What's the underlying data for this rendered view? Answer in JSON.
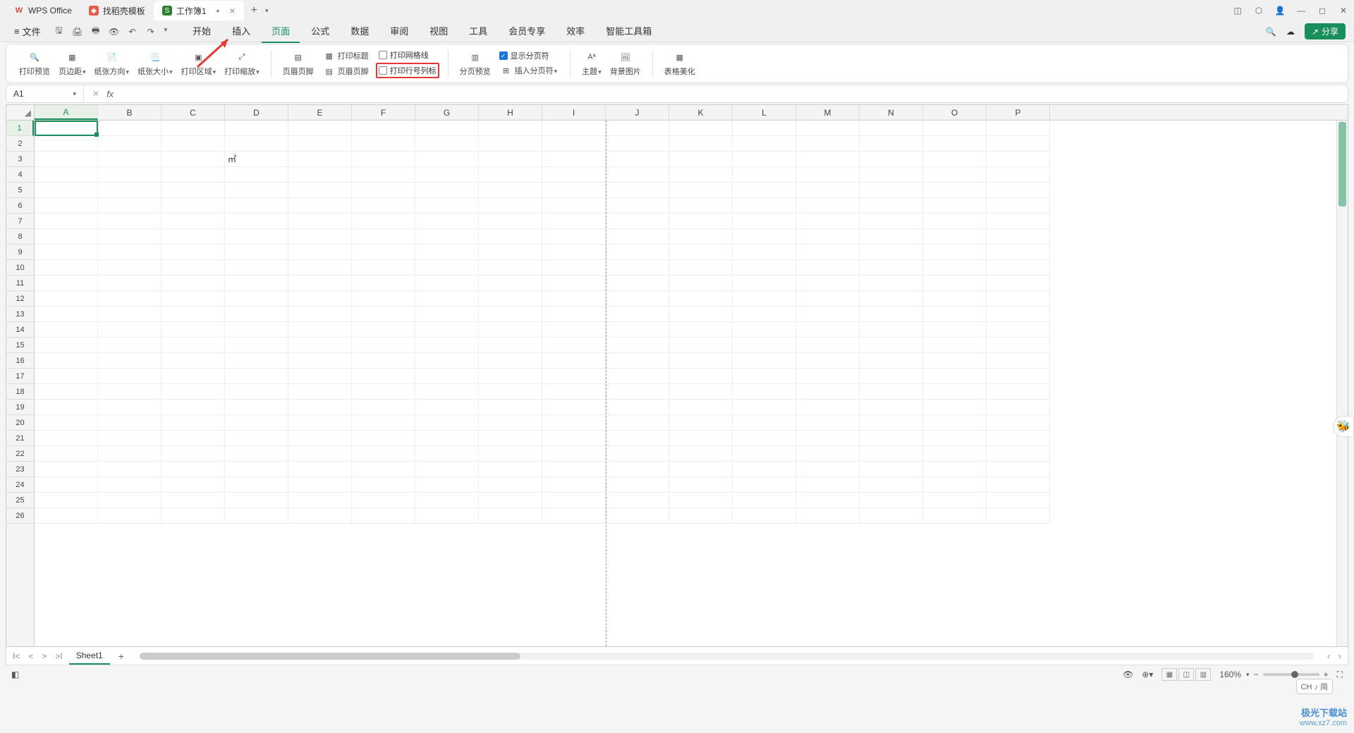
{
  "titlebar": {
    "tabs": [
      {
        "icon": "W",
        "label": "WPS Office"
      },
      {
        "icon": "D",
        "label": "找稻壳模板"
      },
      {
        "icon": "S",
        "label": "工作簿1",
        "active": true,
        "dirty": "•"
      }
    ],
    "add": "+"
  },
  "menubar": {
    "file_label": "文件",
    "tabs": [
      "开始",
      "插入",
      "页面",
      "公式",
      "数据",
      "审阅",
      "视图",
      "工具",
      "会员专享",
      "效率",
      "智能工具箱"
    ],
    "active_tab": "页面",
    "share": "分享"
  },
  "ribbon": {
    "print_preview": "打印预览",
    "margins": "页边距",
    "orientation": "纸张方向",
    "size": "纸张大小",
    "print_area": "打印区域",
    "print_scaling": "打印缩放",
    "header_footer": "页眉页脚",
    "print_titles": "打印标题",
    "print_gridlines": "打印网格线",
    "print_row_col": "打印行号列标",
    "page_break_preview": "分页预览",
    "show_page_breaks": "显示分页符",
    "insert_page_break": "插入分页符",
    "theme": "主题",
    "background": "背景图片",
    "beautify": "表格美化"
  },
  "namebox": {
    "value": "A1"
  },
  "formula": {
    "fx": "fx",
    "value": ""
  },
  "columns": [
    "A",
    "B",
    "C",
    "D",
    "E",
    "F",
    "G",
    "H",
    "I",
    "J",
    "K",
    "L",
    "M",
    "N",
    "O",
    "P"
  ],
  "rows": [
    1,
    2,
    3,
    4,
    5,
    6,
    7,
    8,
    9,
    10,
    11,
    12,
    13,
    14,
    15,
    16,
    17,
    18,
    19,
    20,
    21,
    22,
    23,
    24,
    25,
    26
  ],
  "cells": {
    "D3": "㎡"
  },
  "sheet": {
    "name": "Sheet1",
    "add": "+"
  },
  "statusbar": {
    "ime": "CH ♪ 简",
    "zoom": "160%"
  },
  "watermark": {
    "logo": "极光下载站",
    "url": "www.xz7.com"
  }
}
